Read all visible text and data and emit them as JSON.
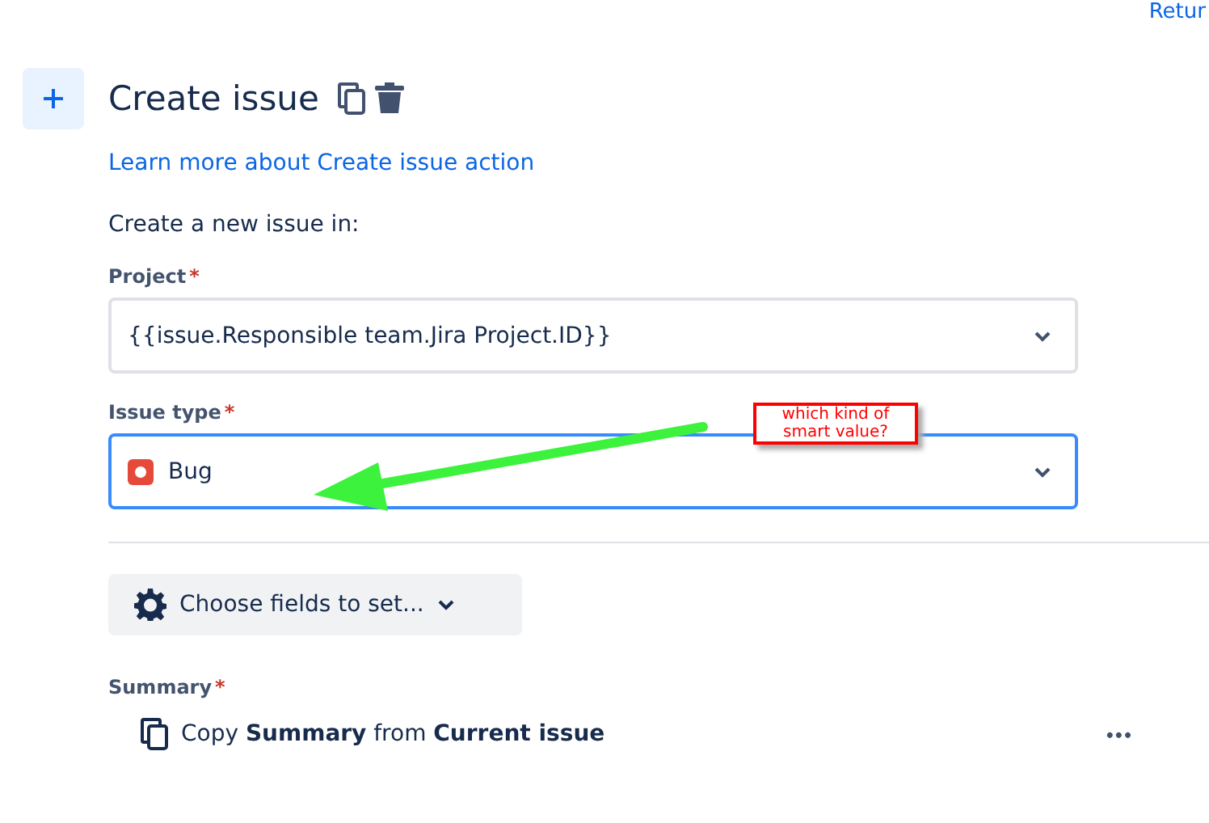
{
  "top_link": "Retur",
  "title": "Create issue",
  "learn_link": "Learn more about Create issue action",
  "intro": "Create a new issue in:",
  "fields": [
    {
      "label": "Project",
      "required_mark": "*",
      "value": "{{issue.Responsible team.Jira Project.ID}}",
      "focused": false,
      "kind": "text"
    },
    {
      "label": "Issue type",
      "required_mark": "*",
      "value": "Bug",
      "focused": true,
      "kind": "bug"
    }
  ],
  "choose_button": "Choose fields to set...",
  "summary": {
    "label": "Summary",
    "required_mark": "*",
    "text": "Copy **Summary** from **Current issue**",
    "more": "•••"
  },
  "annotation": {
    "text": "which kind of smart value?"
  }
}
